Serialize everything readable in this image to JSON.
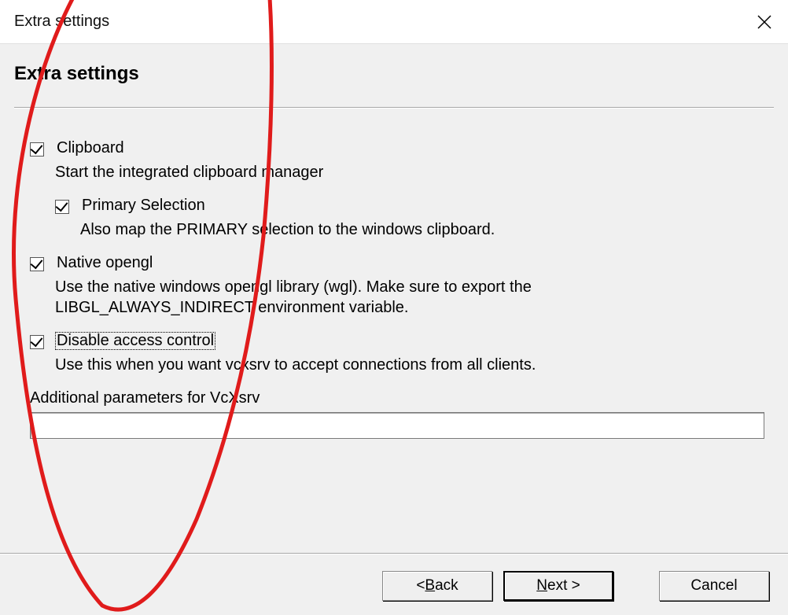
{
  "window": {
    "title": "Extra settings"
  },
  "header": {
    "title": "Extra settings"
  },
  "options": {
    "clipboard": {
      "label": "Clipboard",
      "checked": true,
      "desc": "Start the integrated clipboard manager"
    },
    "primary": {
      "label": "Primary Selection",
      "checked": true,
      "desc": "Also map the PRIMARY selection to the windows clipboard."
    },
    "opengl": {
      "label": "Native opengl",
      "checked": true,
      "desc": "Use the native windows opengl library (wgl). Make sure to export the LIBGL_ALWAYS_INDIRECT environment variable."
    },
    "noaccess": {
      "label": "Disable access control",
      "checked": true,
      "desc": "Use this when you want vcxsrv to accept connections from all clients."
    }
  },
  "params": {
    "label": "Additional parameters for VcXsrv",
    "value": ""
  },
  "footer": {
    "back_pre": "< ",
    "back_accel": "B",
    "back_post": "ack",
    "next_accel": "N",
    "next_post": "ext >",
    "cancel": "Cancel"
  },
  "annotation": {
    "present": true,
    "color": "#e01b1b",
    "shape": "hand-drawn-oval"
  }
}
